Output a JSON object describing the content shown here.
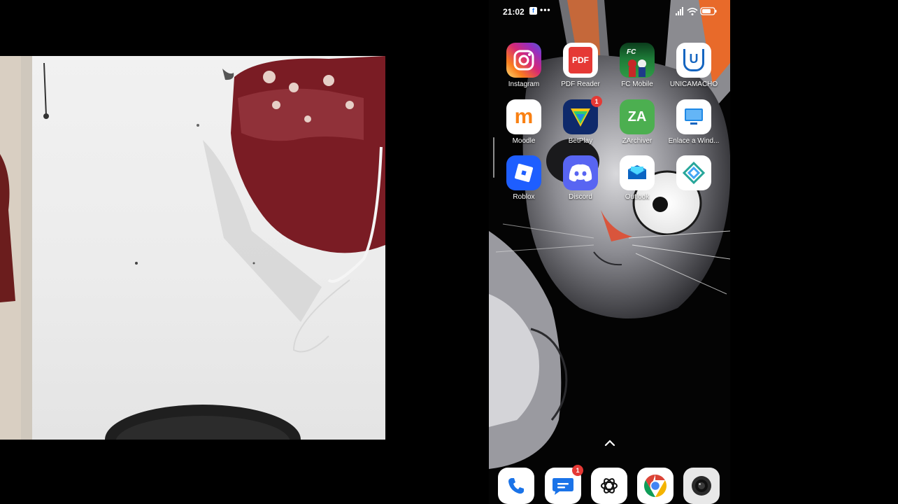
{
  "status_bar": {
    "time": "21:02",
    "notification_app": "f",
    "more_dots": "•••"
  },
  "apps": [
    {
      "id": "instagram",
      "label": "Instagram",
      "icon": "instagram-icon"
    },
    {
      "id": "pdf-reader",
      "label": "PDF Reader",
      "icon": "pdf-icon",
      "icon_text": "PDF"
    },
    {
      "id": "fc-mobile",
      "label": "FC Mobile",
      "icon": "fc-mobile-icon"
    },
    {
      "id": "unicamacho",
      "label": "UNICAMACHO",
      "icon": "unicamacho-icon",
      "icon_text": "U"
    },
    {
      "id": "moodle",
      "label": "Moodle",
      "icon": "moodle-icon",
      "icon_text": "m"
    },
    {
      "id": "betplay",
      "label": "BetPlay",
      "icon": "betplay-icon",
      "badge": "1"
    },
    {
      "id": "zarchiver",
      "label": "ZArchiver",
      "icon": "zarchiver-icon",
      "icon_text": "ZA"
    },
    {
      "id": "enlace-windows",
      "label": "Enlace a Wind...",
      "icon": "windows-link-icon"
    },
    {
      "id": "roblox",
      "label": "Roblox",
      "icon": "roblox-icon"
    },
    {
      "id": "discord",
      "label": "Discord",
      "icon": "discord-icon"
    },
    {
      "id": "outlook",
      "label": "Outlook",
      "icon": "outlook-icon"
    },
    {
      "id": "unknown-app",
      "label": "",
      "icon": "diamond-app-icon"
    }
  ],
  "dock": [
    {
      "id": "phone",
      "icon": "phone-icon"
    },
    {
      "id": "messages",
      "icon": "messages-icon",
      "badge": "1"
    },
    {
      "id": "chatgpt",
      "icon": "chatgpt-icon"
    },
    {
      "id": "chrome",
      "icon": "chrome-icon"
    },
    {
      "id": "camera",
      "icon": "camera-icon"
    }
  ],
  "colors": {
    "instagram": "#d6249f",
    "pdf": "#e53935",
    "unicamacho": "#1565c0",
    "zarchiver": "#4caf50",
    "roblox": "#1e5eff",
    "discord": "#5865f2",
    "badge": "#e53935"
  }
}
